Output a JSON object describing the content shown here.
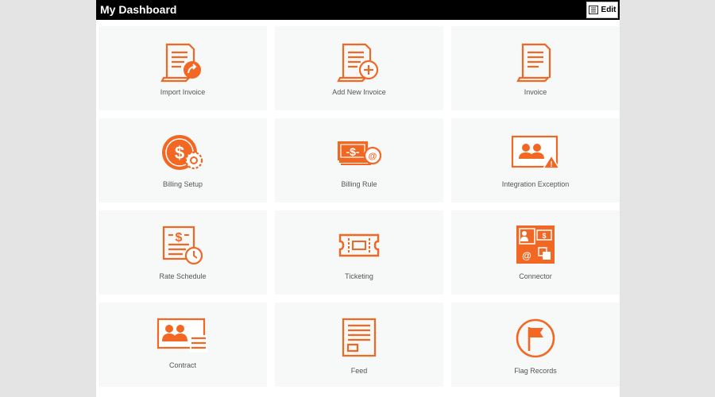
{
  "header": {
    "title": "My Dashboard",
    "edit_label": "Edit"
  },
  "theme": {
    "accent": "#f26722",
    "header_bg": "#000000",
    "tile_bg": "#f7f8f8",
    "label_color": "#555555"
  },
  "tiles": [
    {
      "label": "Import Invoice",
      "icon": "import-invoice-icon"
    },
    {
      "label": "Add New Invoice",
      "icon": "add-invoice-icon"
    },
    {
      "label": "Invoice",
      "icon": "invoice-icon"
    },
    {
      "label": "Billing Setup",
      "icon": "billing-setup-icon"
    },
    {
      "label": "Billing Rule",
      "icon": "billing-rule-icon"
    },
    {
      "label": "Integration Exception",
      "icon": "integration-exception-icon"
    },
    {
      "label": "Rate Schedule",
      "icon": "rate-schedule-icon"
    },
    {
      "label": "Ticketing",
      "icon": "ticketing-icon"
    },
    {
      "label": "Connector",
      "icon": "connector-icon"
    },
    {
      "label": "Contract",
      "icon": "contract-icon"
    },
    {
      "label": "Feed",
      "icon": "feed-icon"
    },
    {
      "label": "Flag Records",
      "icon": "flag-icon"
    }
  ]
}
